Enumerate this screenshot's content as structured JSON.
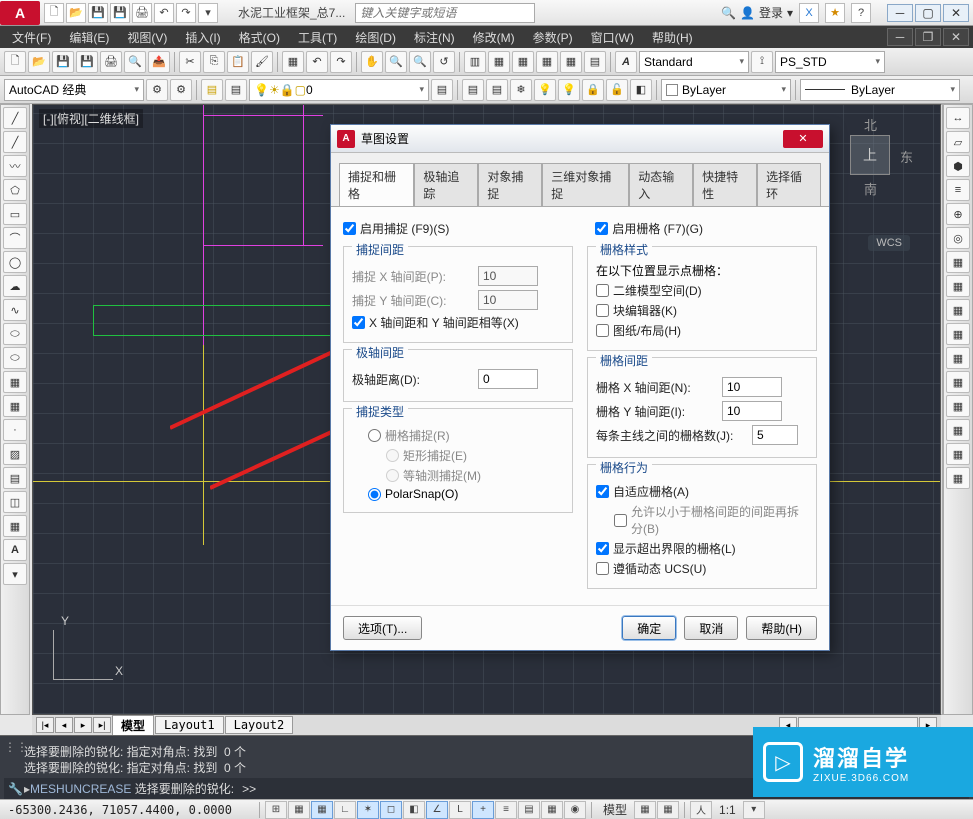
{
  "app": {
    "logo": "A",
    "title": "水泥工业框架_总7..."
  },
  "search": {
    "placeholder": "键入关键字或短语"
  },
  "login": {
    "text": "登录"
  },
  "menu": [
    "文件(F)",
    "编辑(E)",
    "视图(V)",
    "插入(I)",
    "格式(O)",
    "工具(T)",
    "绘图(D)",
    "标注(N)",
    "修改(M)",
    "参数(P)",
    "窗口(W)",
    "帮助(H)"
  ],
  "workspaces": {
    "combo": "AutoCAD 经典"
  },
  "layer": {
    "combo0": "0"
  },
  "style": {
    "text_style": "Standard",
    "dim_style": "PS_STD"
  },
  "props": {
    "bylayer1": "ByLayer",
    "bylayer2": "ByLayer"
  },
  "view": {
    "label": "[-][俯视][二维线框]"
  },
  "cube": {
    "top": "上",
    "n": "北",
    "s": "南",
    "e": "东",
    "wcs": "WCS"
  },
  "ucs": {
    "x": "X",
    "y": "Y"
  },
  "model_tabs": {
    "model": "模型",
    "l1": "Layout1",
    "l2": "Layout2"
  },
  "cmd": {
    "h1": "选择要删除的锐化: 指定对角点: 找到  0 个",
    "h2": "选择要删除的锐化: 指定对角点: 找到  0 个",
    "prompt_cmd": "MESHUNCREASE",
    "prompt_text": " 选择要删除的锐化:",
    "caret": ">>"
  },
  "status": {
    "coords": "-65300.2436, 71057.4400, 0.0000",
    "model": "模型",
    "scale": "1:1"
  },
  "dialog": {
    "title": "草图设置",
    "tabs": [
      "捕捉和栅格",
      "极轴追踪",
      "对象捕捉",
      "三维对象捕捉",
      "动态输入",
      "快捷特性",
      "选择循环"
    ],
    "enable_snap": "启用捕捉 (F9)(S)",
    "enable_grid": "启用栅格 (F7)(G)",
    "snap_spacing": {
      "legend": "捕捉间距",
      "x_label": "捕捉 X 轴间距(P):",
      "x_val": "10",
      "y_label": "捕捉 Y 轴间距(C):",
      "y_val": "10",
      "equal": "X 轴间距和 Y 轴间距相等(X)"
    },
    "polar_spacing": {
      "legend": "极轴间距",
      "label": "极轴距离(D):",
      "val": "0"
    },
    "snap_type": {
      "legend": "捕捉类型",
      "grid": "栅格捕捉(R)",
      "rect": "矩形捕捉(E)",
      "iso": "等轴测捕捉(M)",
      "polar": "PolarSnap(O)"
    },
    "grid_style": {
      "legend": "栅格样式",
      "sub": "在以下位置显示点栅格：",
      "a": "二维模型空间(D)",
      "b": "块编辑器(K)",
      "c": "图纸/布局(H)"
    },
    "grid_spacing": {
      "legend": "栅格间距",
      "x_label": "栅格 X 轴间距(N):",
      "x_val": "10",
      "y_label": "栅格 Y 轴间距(I):",
      "y_val": "10",
      "m_label": "每条主线之间的栅格数(J):",
      "m_val": "5"
    },
    "grid_behavior": {
      "legend": "栅格行为",
      "adaptive": "自适应栅格(A)",
      "subdiv": "允许以小于栅格间距的间距再拆分(B)",
      "beyond": "显示超出界限的栅格(L)",
      "followucs": "遵循动态 UCS(U)"
    },
    "options_btn": "选项(T)...",
    "ok": "确定",
    "cancel": "取消",
    "help": "帮助(H)"
  },
  "watermark": {
    "main": "溜溜自学",
    "sub": "ZIXUE.3D66.COM"
  }
}
